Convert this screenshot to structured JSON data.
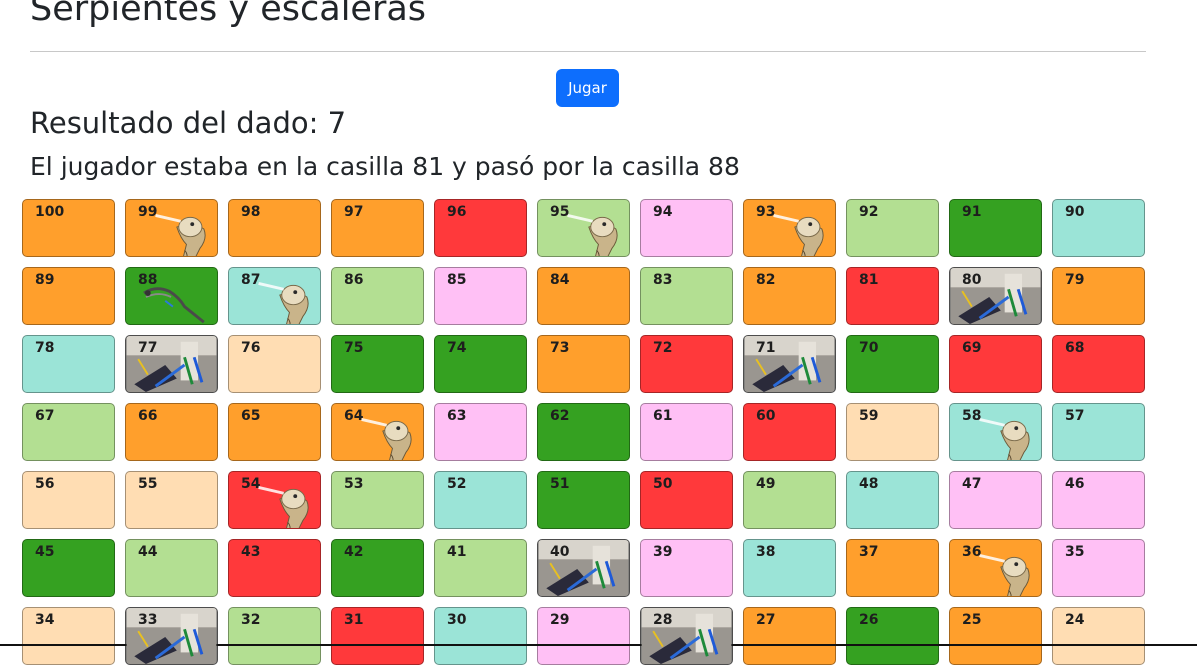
{
  "page": {
    "title": "Serpientes y escaleras",
    "play_label": "Jugar",
    "dice_text": "Resultado del dado: 7",
    "move_text": "El jugador estaba en la casilla 81 y pasó por la casilla 88"
  },
  "colors": {
    "orange": "#ff9f2c",
    "red": "#ff393b",
    "lightgreen": "#b3df92",
    "darkgreen": "#35a121",
    "pink": "#ffc0f5",
    "teal": "#9be4d7",
    "peach": "#ffddb3",
    "button": "#0d6efd"
  },
  "board": {
    "rows": [
      [
        {
          "n": "100",
          "c": "orange"
        },
        {
          "n": "99",
          "c": "orange",
          "icon": "snake-head-icon"
        },
        {
          "n": "98",
          "c": "orange"
        },
        {
          "n": "97",
          "c": "orange"
        },
        {
          "n": "96",
          "c": "red"
        },
        {
          "n": "95",
          "c": "lightgreen",
          "icon": "snake-head-icon"
        },
        {
          "n": "94",
          "c": "pink"
        },
        {
          "n": "93",
          "c": "orange",
          "icon": "snake-head-icon"
        },
        {
          "n": "92",
          "c": "lightgreen"
        },
        {
          "n": "91",
          "c": "darkgreen"
        },
        {
          "n": "90",
          "c": "teal"
        }
      ],
      [
        {
          "n": "89",
          "c": "orange"
        },
        {
          "n": "88",
          "c": "darkgreen",
          "icon": "snake-tail-icon"
        },
        {
          "n": "87",
          "c": "teal",
          "icon": "snake-head-icon"
        },
        {
          "n": "86",
          "c": "lightgreen"
        },
        {
          "n": "85",
          "c": "pink"
        },
        {
          "n": "84",
          "c": "orange"
        },
        {
          "n": "83",
          "c": "lightgreen"
        },
        {
          "n": "82",
          "c": "orange"
        },
        {
          "n": "81",
          "c": "red"
        },
        {
          "n": "80",
          "c": "photo",
          "icon": "ladder-photo-icon"
        },
        {
          "n": "79",
          "c": "orange"
        }
      ],
      [
        {
          "n": "78",
          "c": "teal"
        },
        {
          "n": "77",
          "c": "photo",
          "icon": "ladder-photo-icon"
        },
        {
          "n": "76",
          "c": "peach"
        },
        {
          "n": "75",
          "c": "darkgreen"
        },
        {
          "n": "74",
          "c": "darkgreen"
        },
        {
          "n": "73",
          "c": "orange"
        },
        {
          "n": "72",
          "c": "red"
        },
        {
          "n": "71",
          "c": "photo",
          "icon": "ladder-photo-icon"
        },
        {
          "n": "70",
          "c": "darkgreen"
        },
        {
          "n": "69",
          "c": "red"
        },
        {
          "n": "68",
          "c": "red"
        }
      ],
      [
        {
          "n": "67",
          "c": "lightgreen"
        },
        {
          "n": "66",
          "c": "orange"
        },
        {
          "n": "65",
          "c": "orange"
        },
        {
          "n": "64",
          "c": "orange",
          "icon": "snake-head-icon"
        },
        {
          "n": "63",
          "c": "pink"
        },
        {
          "n": "62",
          "c": "darkgreen"
        },
        {
          "n": "61",
          "c": "pink"
        },
        {
          "n": "60",
          "c": "red"
        },
        {
          "n": "59",
          "c": "peach"
        },
        {
          "n": "58",
          "c": "teal",
          "icon": "snake-head-icon"
        },
        {
          "n": "57",
          "c": "teal"
        }
      ],
      [
        {
          "n": "56",
          "c": "peach"
        },
        {
          "n": "55",
          "c": "peach"
        },
        {
          "n": "54",
          "c": "red",
          "icon": "snake-head-icon"
        },
        {
          "n": "53",
          "c": "lightgreen"
        },
        {
          "n": "52",
          "c": "teal"
        },
        {
          "n": "51",
          "c": "darkgreen"
        },
        {
          "n": "50",
          "c": "red"
        },
        {
          "n": "49",
          "c": "lightgreen"
        },
        {
          "n": "48",
          "c": "teal"
        },
        {
          "n": "47",
          "c": "pink"
        },
        {
          "n": "46",
          "c": "pink"
        }
      ],
      [
        {
          "n": "45",
          "c": "darkgreen"
        },
        {
          "n": "44",
          "c": "lightgreen"
        },
        {
          "n": "43",
          "c": "red"
        },
        {
          "n": "42",
          "c": "darkgreen"
        },
        {
          "n": "41",
          "c": "lightgreen"
        },
        {
          "n": "40",
          "c": "photo",
          "icon": "ladder-photo-icon"
        },
        {
          "n": "39",
          "c": "pink"
        },
        {
          "n": "38",
          "c": "teal"
        },
        {
          "n": "37",
          "c": "orange"
        },
        {
          "n": "36",
          "c": "orange",
          "icon": "snake-head-icon"
        },
        {
          "n": "35",
          "c": "pink"
        }
      ],
      [
        {
          "n": "34",
          "c": "peach"
        },
        {
          "n": "33",
          "c": "photo",
          "icon": "ladder-photo-icon"
        },
        {
          "n": "32",
          "c": "lightgreen"
        },
        {
          "n": "31",
          "c": "red"
        },
        {
          "n": "30",
          "c": "teal"
        },
        {
          "n": "29",
          "c": "pink"
        },
        {
          "n": "28",
          "c": "photo",
          "icon": "ladder-photo-icon"
        },
        {
          "n": "27",
          "c": "orange"
        },
        {
          "n": "26",
          "c": "darkgreen"
        },
        {
          "n": "25",
          "c": "orange"
        },
        {
          "n": "24",
          "c": "peach"
        }
      ]
    ]
  }
}
